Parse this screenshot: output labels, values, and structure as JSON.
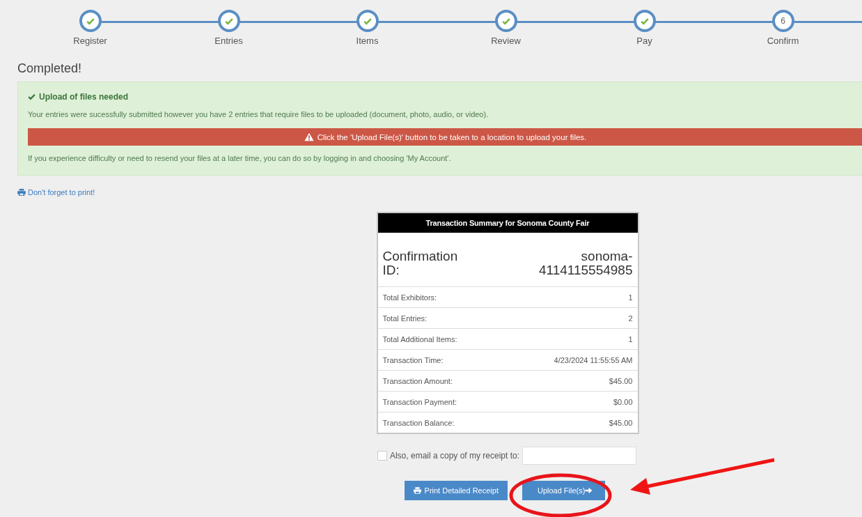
{
  "steps": [
    {
      "label": "Register",
      "done": true
    },
    {
      "label": "Entries",
      "done": true
    },
    {
      "label": "Items",
      "done": true
    },
    {
      "label": "Review",
      "done": true
    },
    {
      "label": "Pay",
      "done": true
    },
    {
      "label": "Confirm",
      "done": false,
      "number": "6"
    }
  ],
  "heading": "Completed!",
  "alert": {
    "title": "Upload of files needed",
    "message": "Your entries were sucessfully submitted however you have 2 entries that require files to be uploaded (document, photo, audio, or video).",
    "warning": "Click the 'Upload File(s)' button to be taken to a location to upload your files.",
    "note": "If you experience difficulty or need to resend your files at a later time, you can do so by logging in and choosing 'My Account'."
  },
  "print_link": "Don't forget to print!",
  "summary": {
    "title": "Transaction Summary for Sonoma County Fair",
    "confirmation_label": "Confirmation ID:",
    "confirmation_id": "sonoma-4114115554985",
    "rows": [
      {
        "label": "Total Exhibitors:",
        "value": "1"
      },
      {
        "label": "Total Entries:",
        "value": "2"
      },
      {
        "label": "Total Additional Items:",
        "value": "1"
      },
      {
        "label": "Transaction Time:",
        "value": "4/23/2024 11:55:55 AM"
      },
      {
        "label": "Transaction Amount:",
        "value": "$45.00"
      },
      {
        "label": "Transaction Payment:",
        "value": "$0.00"
      },
      {
        "label": "Transaction Balance:",
        "value": "$45.00"
      }
    ]
  },
  "email": {
    "label": "Also, email a copy of my receipt to:",
    "checked": false
  },
  "buttons": [
    {
      "label": "Print Detailed Receipt",
      "kind": "print"
    },
    {
      "label": "Upload File(s)",
      "kind": "upload"
    }
  ]
}
